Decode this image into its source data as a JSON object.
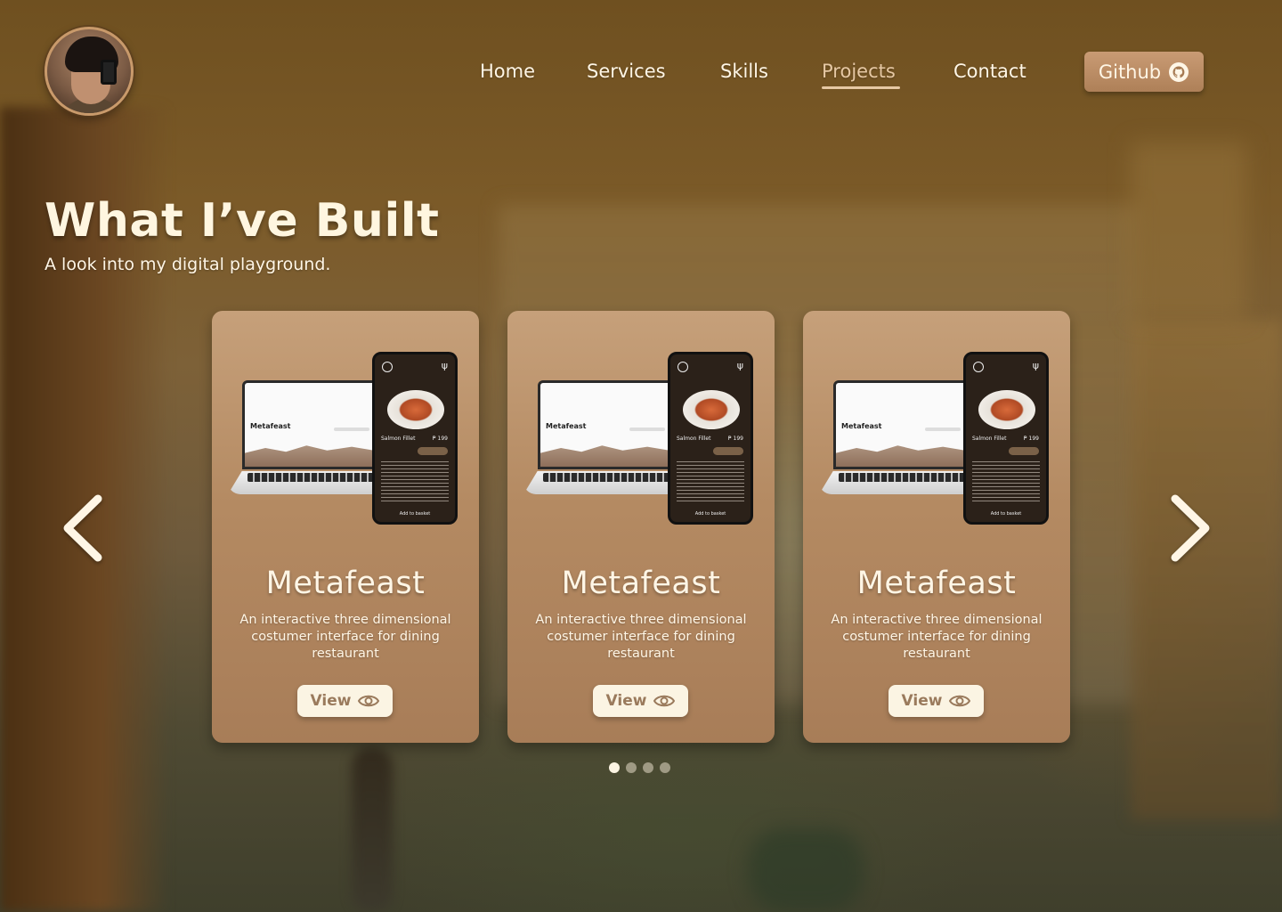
{
  "header": {
    "nav": [
      {
        "label": "Home"
      },
      {
        "label": "Services"
      },
      {
        "label": "Skills"
      },
      {
        "label": "Projects"
      },
      {
        "label": "Contact"
      }
    ],
    "active_nav": "Projects",
    "github_label": "Github"
  },
  "hero": {
    "title": "What I’ve Built",
    "subtitle": "A look into my digital playground."
  },
  "cards": [
    {
      "title": "Metafeast",
      "description": "An interactive three dimensional costumer interface for dining restaurant",
      "view_label": "View",
      "mockup": {
        "laptop_title": "Metafeast",
        "dish": "Salmon Fillet",
        "price": "₱ 199",
        "button": "Add to basket"
      }
    },
    {
      "title": "Metafeast",
      "description": "An interactive three dimensional costumer interface for dining restaurant",
      "view_label": "View",
      "mockup": {
        "laptop_title": "Metafeast",
        "dish": "Salmon Fillet",
        "price": "₱ 199",
        "button": "Add to basket"
      }
    },
    {
      "title": "Metafeast",
      "description": "An interactive three dimensional costumer interface for dining restaurant",
      "view_label": "View",
      "mockup": {
        "laptop_title": "Metafeast",
        "dish": "Salmon Fillet",
        "price": "₱ 199",
        "button": "Add to basket"
      }
    }
  ],
  "carousel": {
    "page_count": 4,
    "active_page": 1
  },
  "icons": {
    "github": "github-icon",
    "view": "eye-icon",
    "prev": "chevron-left-icon",
    "next": "chevron-right-icon"
  },
  "colors": {
    "accent": "#e6c8a4",
    "card": "#b48a62",
    "button_bg": "#fbf4e3"
  }
}
